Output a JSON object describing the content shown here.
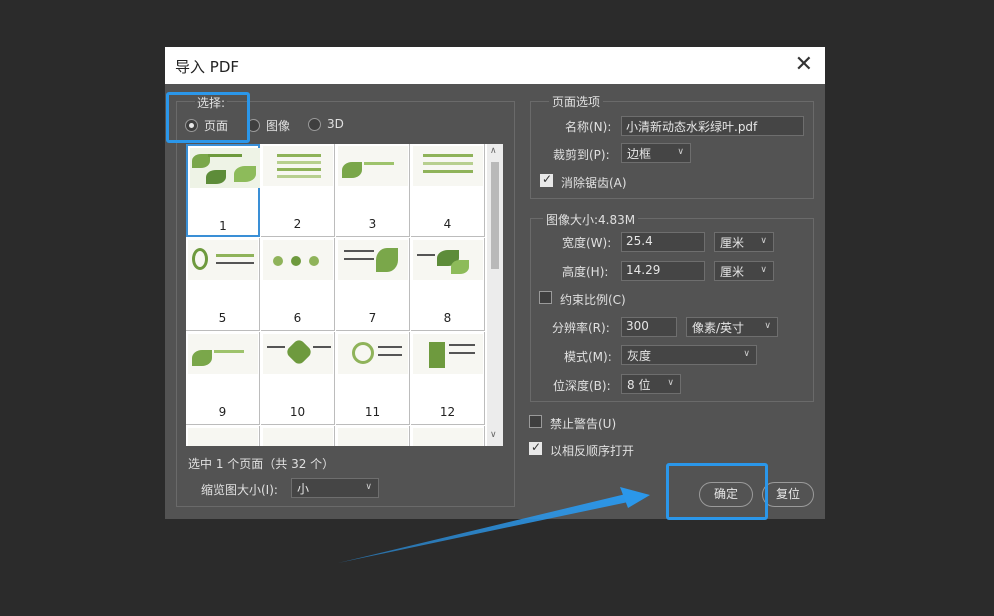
{
  "dialog": {
    "title": "导入 PDF",
    "close_glyph": "✕",
    "select_legend": "选择:",
    "radio_options": [
      {
        "label": "页面",
        "checked": true
      },
      {
        "label": "图像",
        "checked": false
      },
      {
        "label": "3D",
        "checked": false
      }
    ],
    "thumbnails": [
      "1",
      "2",
      "3",
      "4",
      "5",
      "6",
      "7",
      "8",
      "9",
      "10",
      "11",
      "12"
    ],
    "selection_status": "选中 1 个页面（共 32 个）",
    "thumb_size_label": "缩览图大小(I):",
    "thumb_size_value": "小"
  },
  "page_options": {
    "legend": "页面选项",
    "name_label": "名称(N):",
    "name_value": "小清新动态水彩绿叶.pdf",
    "crop_label": "裁剪到(P):",
    "crop_value": "边框",
    "antialias_label": "消除锯齿(A)",
    "antialias_checked": true
  },
  "image_size": {
    "legend": "图像大小:4.83M",
    "width_label": "宽度(W):",
    "width_value": "25.4",
    "width_unit": "厘米",
    "height_label": "高度(H):",
    "height_value": "14.29",
    "height_unit": "厘米",
    "constrain_label": "约束比例(C)",
    "constrain_checked": false,
    "resolution_label": "分辨率(R):",
    "resolution_value": "300",
    "resolution_unit": "像素/英寸",
    "mode_label": "模式(M):",
    "mode_value": "灰度",
    "depth_label": "位深度(B):",
    "depth_value": "8 位"
  },
  "options": {
    "suppress_warnings_label": "禁止警告(U)",
    "suppress_warnings_checked": false,
    "reverse_order_label": "以相反顺序打开",
    "reverse_order_checked": true
  },
  "buttons": {
    "ok": "确定",
    "reset": "复位"
  },
  "colors": {
    "highlight": "#2b97ea",
    "dialog_bg": "#535353",
    "thumb_selected": "#3a8fd6"
  }
}
